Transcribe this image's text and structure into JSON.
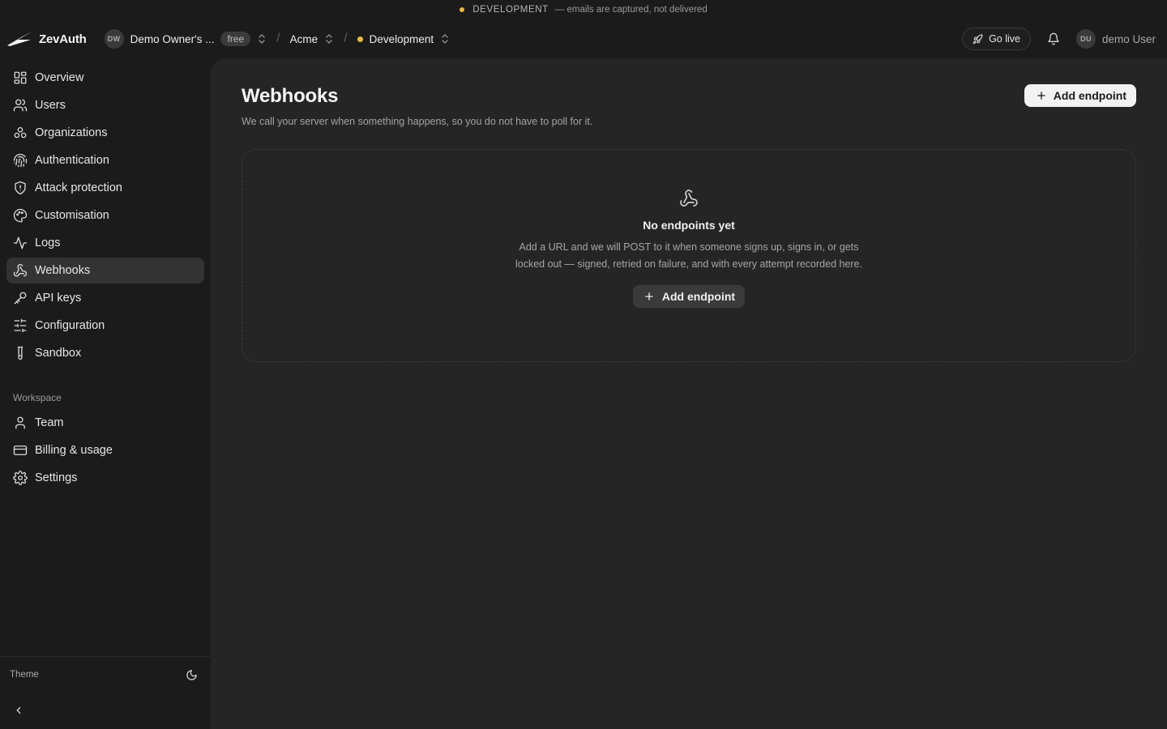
{
  "banner": {
    "env_name": "DEVELOPMENT",
    "message": "— emails are captured, not delivered",
    "dot_color": "#e7b949"
  },
  "header": {
    "brand": "ZevAuth",
    "org": {
      "initials": "DW",
      "name": "Demo Owner's ...",
      "plan": "free"
    },
    "project": "Acme",
    "environment": {
      "name": "Development",
      "dot_color": "#e7b949"
    },
    "go_live_label": "Go live",
    "user": {
      "initials": "DU",
      "name": "demo User"
    }
  },
  "sidebar": {
    "items": [
      {
        "label": "Overview",
        "icon": "grid-icon"
      },
      {
        "label": "Users",
        "icon": "users-icon"
      },
      {
        "label": "Organizations",
        "icon": "organizations-icon"
      },
      {
        "label": "Authentication",
        "icon": "fingerprint-icon"
      },
      {
        "label": "Attack protection",
        "icon": "shield-icon"
      },
      {
        "label": "Customisation",
        "icon": "palette-icon"
      },
      {
        "label": "Logs",
        "icon": "activity-icon"
      },
      {
        "label": "Webhooks",
        "icon": "webhook-icon",
        "active": true
      },
      {
        "label": "API keys",
        "icon": "key-icon"
      },
      {
        "label": "Configuration",
        "icon": "sliders-icon"
      },
      {
        "label": "Sandbox",
        "icon": "test-tube-icon"
      }
    ],
    "workspace_heading": "Workspace",
    "workspace_items": [
      {
        "label": "Team",
        "icon": "user-icon"
      },
      {
        "label": "Billing & usage",
        "icon": "credit-card-icon"
      },
      {
        "label": "Settings",
        "icon": "gear-icon"
      }
    ],
    "theme_label": "Theme"
  },
  "main": {
    "title": "Webhooks",
    "subtitle": "We call your server when something happens, so you do not have to poll for it.",
    "add_button_label": "Add endpoint",
    "empty_state": {
      "title": "No endpoints yet",
      "description": "Add a URL and we will POST to it when someone signs up, signs in, or gets locked out — signed, retried on failure, and with every attempt recorded here.",
      "button_label": "Add endpoint"
    }
  }
}
